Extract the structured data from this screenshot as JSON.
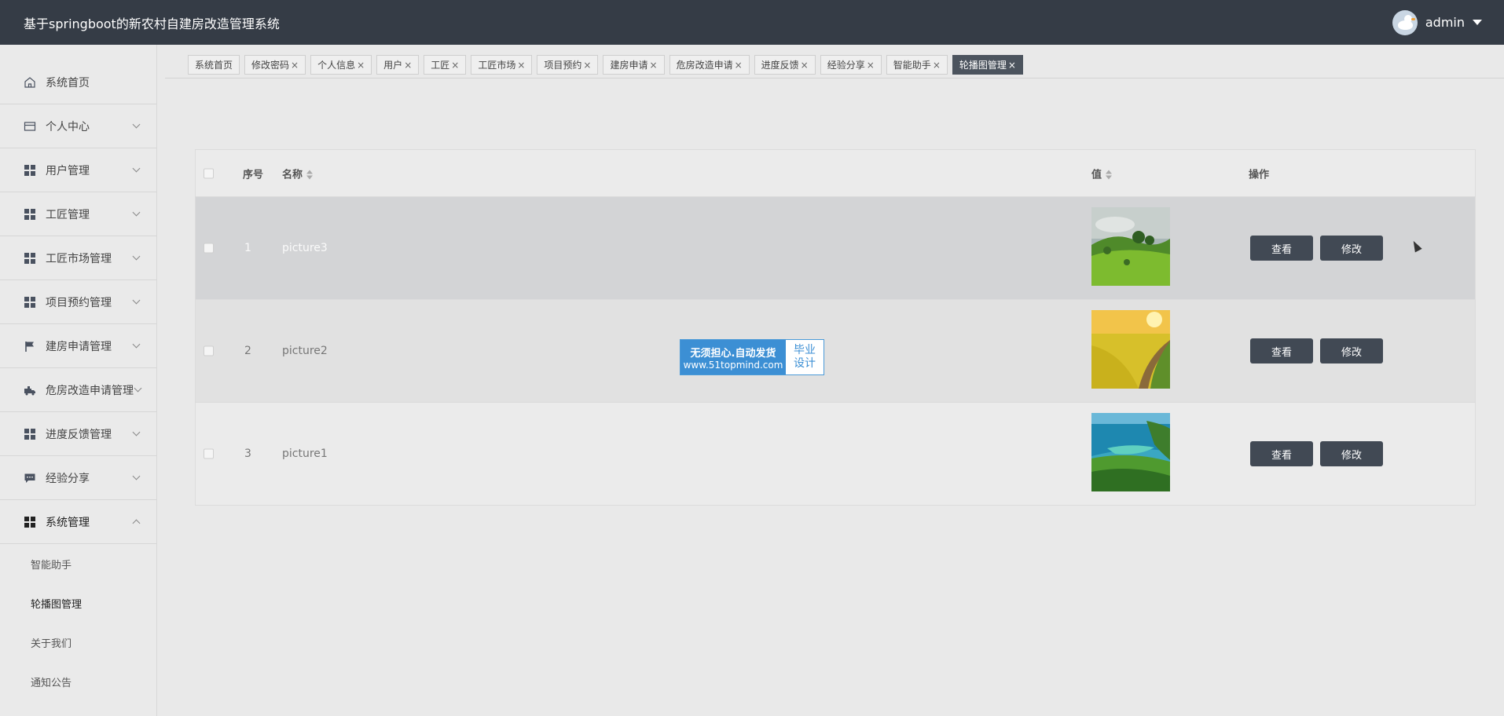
{
  "header": {
    "title": "基于springboot的新农村自建房改造管理系统",
    "user": "admin"
  },
  "sidebar": {
    "items": [
      {
        "label": "系统首页",
        "icon": "home-icon"
      },
      {
        "label": "个人中心",
        "icon": "card-icon"
      },
      {
        "label": "用户管理",
        "icon": "grid-icon"
      },
      {
        "label": "工匠管理",
        "icon": "grid-icon"
      },
      {
        "label": "工匠市场管理",
        "icon": "grid-icon"
      },
      {
        "label": "项目预约管理",
        "icon": "grid-icon"
      },
      {
        "label": "建房申请管理",
        "icon": "flag-icon"
      },
      {
        "label": "危房改造申请管理",
        "icon": "truck-icon"
      },
      {
        "label": "进度反馈管理",
        "icon": "grid-icon"
      },
      {
        "label": "经验分享",
        "icon": "chat-icon"
      },
      {
        "label": "系统管理",
        "icon": "grid-icon"
      }
    ],
    "submenu": [
      "智能助手",
      "轮播图管理",
      "关于我们",
      "通知公告"
    ]
  },
  "tabs": [
    "系统首页",
    "修改密码",
    "个人信息",
    "用户",
    "工匠",
    "工匠市场",
    "项目预约",
    "建房申请",
    "危房改造申请",
    "进度反馈",
    "经验分享",
    "智能助手",
    "轮播图管理"
  ],
  "tab_close": "×",
  "table": {
    "headers": {
      "index": "序号",
      "name": "名称",
      "value": "值",
      "actions": "操作"
    },
    "rows": [
      {
        "index": "1",
        "name": "picture3"
      },
      {
        "index": "2",
        "name": "picture2"
      },
      {
        "index": "3",
        "name": "picture1"
      }
    ],
    "view_label": "查看",
    "edit_label": "修改"
  },
  "watermark": {
    "line1": "无须担心.自动发货",
    "line2": "www.51topmind.com",
    "right1": "毕业",
    "right2": "设计"
  },
  "colors": {
    "header_bg": "#353c46",
    "button_bg": "#414954",
    "active_tab": "#4c545e"
  }
}
